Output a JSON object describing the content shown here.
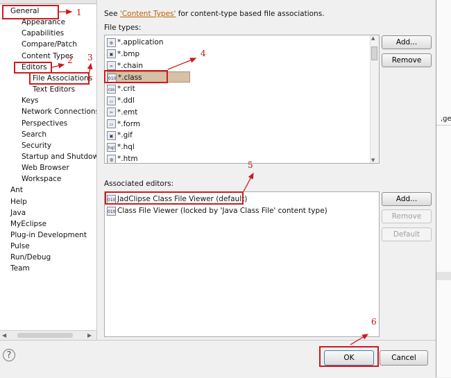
{
  "tree": {
    "top_item": "General",
    "items": [
      {
        "label": "General",
        "indent": 1
      },
      {
        "label": "Appearance",
        "indent": 2
      },
      {
        "label": "Capabilities",
        "indent": 2
      },
      {
        "label": "Compare/Patch",
        "indent": 2
      },
      {
        "label": "Content Types",
        "indent": 2
      },
      {
        "label": "Editors",
        "indent": 2
      },
      {
        "label": "File Associations",
        "indent": 3
      },
      {
        "label": "Text Editors",
        "indent": 3
      },
      {
        "label": "Keys",
        "indent": 2
      },
      {
        "label": "Network Connections",
        "indent": 2
      },
      {
        "label": "Perspectives",
        "indent": 2
      },
      {
        "label": "Search",
        "indent": 2
      },
      {
        "label": "Security",
        "indent": 2
      },
      {
        "label": "Startup and Shutdown",
        "indent": 2
      },
      {
        "label": "Web Browser",
        "indent": 2
      },
      {
        "label": "Workspace",
        "indent": 2
      },
      {
        "label": "Ant",
        "indent": 1
      },
      {
        "label": "Help",
        "indent": 1
      },
      {
        "label": "Java",
        "indent": 1
      },
      {
        "label": "MyEclipse",
        "indent": 1
      },
      {
        "label": "Plug-in Development",
        "indent": 1
      },
      {
        "label": "Pulse",
        "indent": 1
      },
      {
        "label": "Run/Debug",
        "indent": 1
      },
      {
        "label": "Team",
        "indent": 1
      }
    ]
  },
  "header": {
    "see_prefix": "See ",
    "link": "'Content Types'",
    "see_suffix": " for content-type based file associations."
  },
  "file_types": {
    "label": "File types:",
    "items": [
      {
        "label": "*.application",
        "icon": "gear-icon"
      },
      {
        "label": "*.bmp",
        "icon": "image-icon"
      },
      {
        "label": "*.chain",
        "icon": "chain-icon"
      },
      {
        "label": "*.class",
        "icon": "class-file-icon",
        "selected": true
      },
      {
        "label": "*.crit",
        "icon": "css-icon"
      },
      {
        "label": "*.ddl",
        "icon": "file-icon"
      },
      {
        "label": "*.emt",
        "icon": "scissors-icon"
      },
      {
        "label": "*.form",
        "icon": "file-icon"
      },
      {
        "label": "*.gif",
        "icon": "image-icon"
      },
      {
        "label": "*.hql",
        "icon": "hql-icon"
      },
      {
        "label": "*.htm",
        "icon": "globe-icon"
      }
    ],
    "add_label": "Add...",
    "remove_label": "Remove"
  },
  "associated_editors": {
    "label": "Associated editors:",
    "items": [
      {
        "label": "JadClipse Class File Viewer (default)",
        "icon": "class-file-icon"
      },
      {
        "label": "Class File Viewer (locked by 'Java Class File' content type)",
        "icon": "class-file-icon"
      }
    ],
    "add_label": "Add...",
    "remove_label": "Remove",
    "default_label": "Default"
  },
  "buttons": {
    "ok": "OK",
    "cancel": "Cancel",
    "help": "?"
  },
  "annotations": [
    "1",
    "2",
    "3",
    "4",
    "5",
    "6"
  ],
  "right_strip_text": ",ge",
  "colors": {
    "annotation": "#d0181e",
    "selection": "#d6c0a6",
    "link": "#c06000"
  }
}
